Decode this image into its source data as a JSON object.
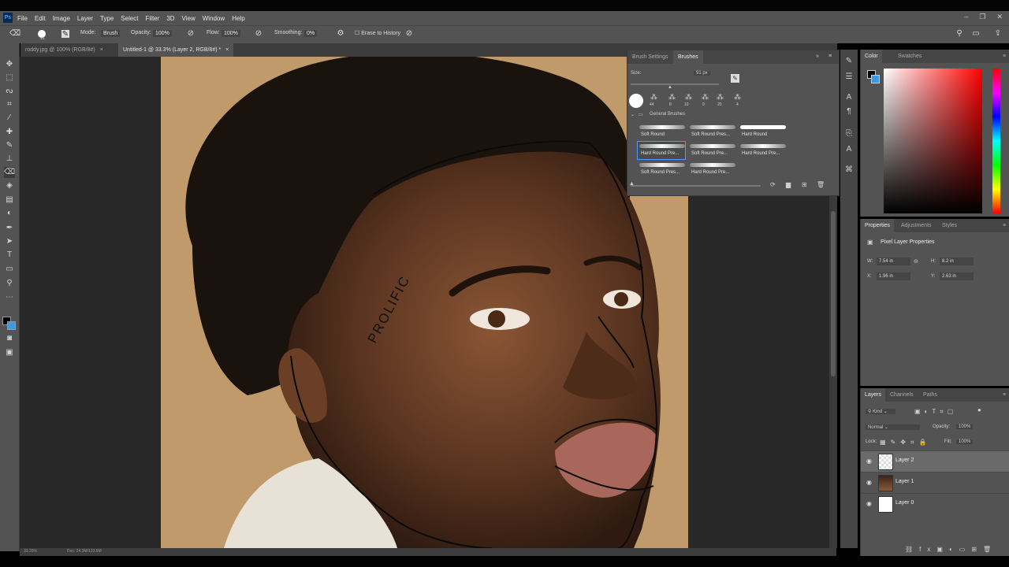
{
  "app": {
    "logo": "Ps"
  },
  "menu": [
    "File",
    "Edit",
    "Image",
    "Layer",
    "Type",
    "Select",
    "Filter",
    "3D",
    "View",
    "Window",
    "Help"
  ],
  "window_controls": {
    "minimize": "–",
    "restore": "❐",
    "close": "✕"
  },
  "options": {
    "brush_size": "91",
    "mode_label": "Mode:",
    "mode_value": "Brush",
    "opacity_label": "Opacity:",
    "opacity_value": "100%",
    "flow_label": "Flow:",
    "flow_value": "100%",
    "smoothing_label": "Smoothing:",
    "smoothing_value": "0%",
    "erase_to_history": "Erase to History"
  },
  "tabs": [
    {
      "label": "roddy.jpg @ 100% (RGB/8#)",
      "close": "×"
    },
    {
      "label": "Untitled-1 @ 33.3% (Layer 2, RGB/8#) *",
      "close": "×"
    }
  ],
  "canvas": {
    "tattoo_text": "PROLIFIC"
  },
  "status": {
    "zoom": "33.33%",
    "doc": "Doc: 24.3M/123.5M"
  },
  "brushes_panel": {
    "tabs": [
      "Brush Settings",
      "Brushes"
    ],
    "size_label": "Size:",
    "size_value": "91 px",
    "presets": [
      "44",
      "8",
      "10",
      "9",
      "20",
      "4"
    ],
    "group": "General Brushes",
    "brushes": [
      [
        "Soft Round",
        "Soft Round Pres...",
        "Hard Round"
      ],
      [
        "Hard Round Pre...",
        "Soft Round Pre...",
        "Hard Round Pre..."
      ],
      [
        "Soft Round Pres...",
        "Hard Round Pre..."
      ]
    ]
  },
  "color_panel": {
    "tabs": [
      "Color",
      "Swatches"
    ],
    "fg": "#000000",
    "bg": "#3e9ae0"
  },
  "properties_panel": {
    "tabs": [
      "Properties",
      "Adjustments",
      "Styles"
    ],
    "title": "Pixel Layer Properties",
    "w_label": "W:",
    "w": "7.54 in",
    "h_label": "H:",
    "h": "8.2 in",
    "x_label": "X:",
    "x": "1.96 in",
    "y_label": "Y:",
    "y": "2.63 in"
  },
  "layers_panel": {
    "tabs": [
      "Layers",
      "Channels",
      "Paths"
    ],
    "filter": "Kind",
    "blend": "Normal",
    "opacity_label": "Opacity:",
    "opacity": "100%",
    "lock_label": "Lock:",
    "fill_label": "Fill:",
    "fill": "100%",
    "layers": [
      {
        "name": "Layer 2",
        "selected": true
      },
      {
        "name": "Layer 1",
        "selected": false
      },
      {
        "name": "Layer 0",
        "selected": false
      }
    ]
  }
}
